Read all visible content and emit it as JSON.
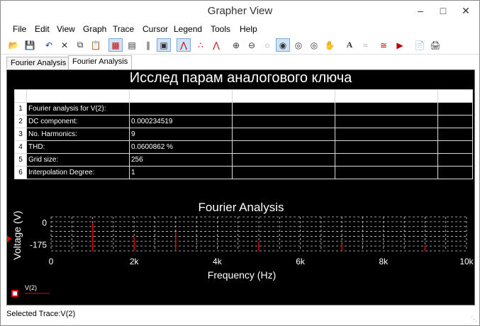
{
  "window": {
    "title": "Grapher View"
  },
  "menu": [
    "File",
    "Edit",
    "View",
    "Graph",
    "Trace",
    "Cursor",
    "Legend",
    "Tools",
    "Help"
  ],
  "tabs": [
    "Fourier Analysis",
    "Fourier Analysis"
  ],
  "panel_title": "Исслед парам аналогового ключа",
  "table": {
    "rows": [
      {
        "num": "1",
        "label": "Fourier analysis for V(2):",
        "value": ""
      },
      {
        "num": "2",
        "label": "DC component:",
        "value": "0.000234519"
      },
      {
        "num": "3",
        "label": "No. Harmonics:",
        "value": "9"
      },
      {
        "num": "4",
        "label": "THD:",
        "value": "0.0600862 %"
      },
      {
        "num": "5",
        "label": "Grid size:",
        "value": "256"
      },
      {
        "num": "6",
        "label": "Interpolation Degree:",
        "value": "1"
      }
    ]
  },
  "chart_data": {
    "type": "bar",
    "title": "Fourier Analysis",
    "xlabel": "Frequency (Hz)",
    "ylabel": "Voltage (V)",
    "xlim": [
      0,
      10000
    ],
    "ylim": [
      -225,
      50
    ],
    "xticks": [
      "0",
      "2k",
      "4k",
      "6k",
      "8k",
      "10k"
    ],
    "yticks": [
      "0",
      "-175"
    ],
    "grid": true,
    "legend_position": "bottom-left",
    "series": [
      {
        "name": "V(2)",
        "color": "#e00000",
        "x": [
          1000,
          2000,
          3000,
          4000,
          5000,
          6000,
          7000,
          8000,
          9000
        ],
        "values": [
          0,
          -115,
          -70,
          -225,
          -150,
          -225,
          -170,
          -225,
          -185
        ]
      }
    ]
  },
  "status": {
    "text": "Selected Trace:V(2)"
  }
}
